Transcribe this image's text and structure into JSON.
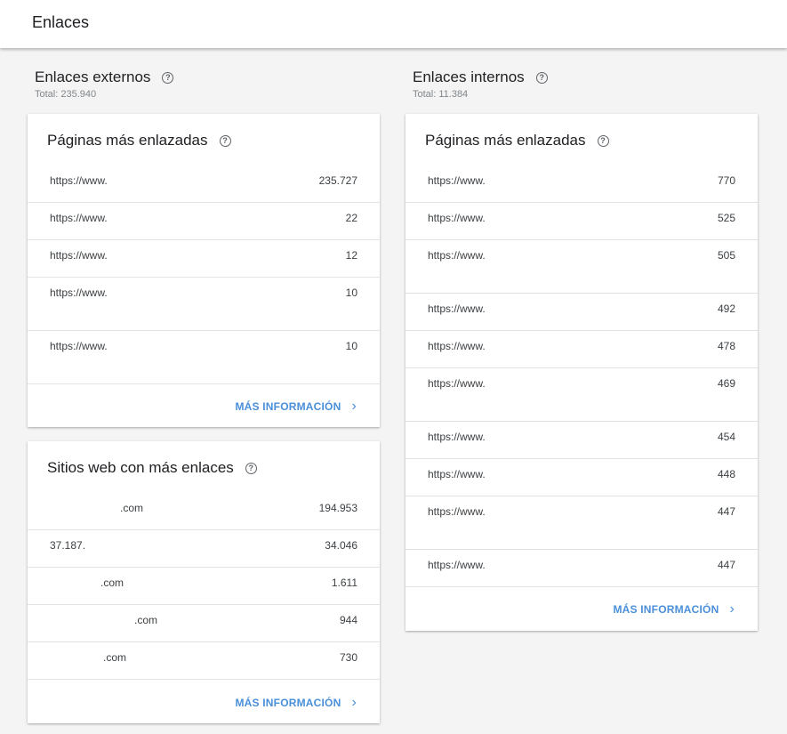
{
  "header": {
    "title": "Enlaces"
  },
  "external": {
    "title": "Enlaces externos",
    "total": "Total: 235.940",
    "top_pages": {
      "title": "Páginas más enlazadas",
      "rows": [
        {
          "k": "https://www.",
          "v": "235.727"
        },
        {
          "k": "https://www.",
          "v": "22"
        },
        {
          "k": "https://www.",
          "v": "12"
        },
        {
          "k": "https://www.",
          "v": "10"
        },
        {
          "k": "https://www.",
          "v": "10"
        }
      ],
      "more": "MÁS INFORMACIÓN"
    },
    "top_sites": {
      "title": "Sitios web con más enlaces",
      "rows": [
        {
          "k": ".com",
          "v": "194.953"
        },
        {
          "k": "37.187.",
          "v": "34.046"
        },
        {
          "k": ".com",
          "v": "1.611"
        },
        {
          "k": ".com",
          "v": "944"
        },
        {
          "k": ".com",
          "v": "730"
        }
      ],
      "more": "MÁS INFORMACIÓN"
    }
  },
  "internal": {
    "title": "Enlaces internos",
    "total": "Total: 11.384",
    "top_pages": {
      "title": "Páginas más enlazadas",
      "rows": [
        {
          "k": "https://www.",
          "v": "770"
        },
        {
          "k": "https://www.",
          "v": "525"
        },
        {
          "k": "https://www.",
          "v": "505"
        },
        {
          "k": "https://www.",
          "v": "492"
        },
        {
          "k": "https://www.",
          "v": "478"
        },
        {
          "k": "https://www.",
          "v": "469"
        },
        {
          "k": "https://www.",
          "v": "454"
        },
        {
          "k": "https://www.",
          "v": "448"
        },
        {
          "k": "https://www.",
          "v": "447"
        },
        {
          "k": "https://www.",
          "v": "447"
        }
      ],
      "more": "MÁS INFORMACIÓN"
    }
  }
}
